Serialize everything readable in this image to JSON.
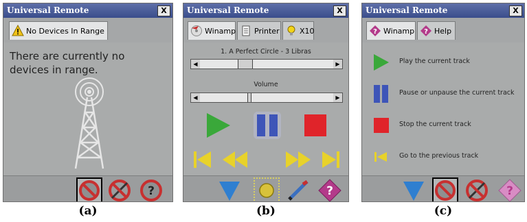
{
  "panels": {
    "a": {
      "title": "Universal Remote",
      "close": "X",
      "tab": "No Devices In Range",
      "message": "There are currently no devices in range.",
      "bottom_icons": [
        "disconnect-icon",
        "cancel-pen-icon",
        "help-disabled-icon"
      ]
    },
    "b": {
      "title": "Universal Remote",
      "close": "X",
      "tabs": [
        "Winamp",
        "Printer",
        "X10"
      ],
      "track": "1. A Perfect Circle - 3 Libras",
      "volume_label": "Volume",
      "track_position": 0.37,
      "volume_level": 0.43,
      "bottom_icons": [
        "down-arrow-icon",
        "connect-icon",
        "pen-icon",
        "help-icon"
      ]
    },
    "c": {
      "title": "Universal Remote",
      "close": "X",
      "tabs": [
        "Winamp",
        "Help"
      ],
      "help_items": [
        {
          "icon": "play-icon",
          "text": "Play the current track"
        },
        {
          "icon": "pause-icon",
          "text": "Pause or unpause the current track"
        },
        {
          "icon": "stop-icon",
          "text": "Stop the current track"
        },
        {
          "icon": "previous-track-icon",
          "text": "Go to the previous track"
        }
      ],
      "bottom_icons": [
        "down-arrow-icon",
        "disconnect-icon",
        "cancel-pen-icon",
        "help-icon"
      ]
    }
  },
  "captions": [
    "(a)",
    "(b)",
    "(c)"
  ],
  "colors": {
    "title_bar": "#3a4d8c",
    "play": "#3aa83a",
    "pause": "#3e55b8",
    "stop": "#e0242a",
    "skip": "#e8d22a",
    "help": "#b33a8a"
  }
}
